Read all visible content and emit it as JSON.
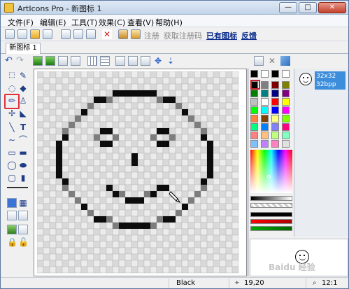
{
  "window": {
    "title": "ArtIcons Pro - 新图标 1",
    "btn_min": "—",
    "btn_max": "□",
    "btn_close": "✕"
  },
  "menu": [
    "文件(F)",
    "编辑(E)",
    "工具(T)",
    "效果(C)",
    "查看(V)",
    "帮助(H)"
  ],
  "toolbar": {
    "register": "注册",
    "get_code": "获取注册码",
    "have_icon": "已有图标",
    "feedback": "反馈"
  },
  "tab": {
    "label": "新图标 1"
  },
  "thumb": {
    "size": "32x32",
    "depth": "32bpp"
  },
  "status": {
    "color_name": "Black",
    "coords": "19,20",
    "zoom": "12:1"
  },
  "watermark": "Baidu 经验",
  "canvas_pixels": {
    "black": [
      [
        12,
        3
      ],
      [
        13,
        3
      ],
      [
        14,
        3
      ],
      [
        15,
        3
      ],
      [
        16,
        3
      ],
      [
        17,
        3
      ],
      [
        18,
        3
      ],
      [
        9,
        4
      ],
      [
        10,
        4
      ],
      [
        11,
        4
      ],
      [
        19,
        4
      ],
      [
        20,
        4
      ],
      [
        21,
        4
      ],
      [
        8,
        5
      ],
      [
        22,
        5
      ],
      [
        7,
        6
      ],
      [
        23,
        6
      ],
      [
        6,
        7
      ],
      [
        24,
        7
      ],
      [
        5,
        8
      ],
      [
        25,
        8
      ],
      [
        4,
        9
      ],
      [
        26,
        9
      ],
      [
        4,
        10
      ],
      [
        26,
        10
      ],
      [
        3,
        11
      ],
      [
        27,
        11
      ],
      [
        3,
        12
      ],
      [
        27,
        12
      ],
      [
        3,
        13
      ],
      [
        27,
        13
      ],
      [
        3,
        14
      ],
      [
        27,
        14
      ],
      [
        3,
        15
      ],
      [
        27,
        15
      ],
      [
        3,
        16
      ],
      [
        27,
        16
      ],
      [
        4,
        17
      ],
      [
        26,
        17
      ],
      [
        4,
        18
      ],
      [
        26,
        18
      ],
      [
        5,
        19
      ],
      [
        25,
        19
      ],
      [
        6,
        20
      ],
      [
        24,
        20
      ],
      [
        7,
        21
      ],
      [
        23,
        21
      ],
      [
        8,
        22
      ],
      [
        22,
        22
      ],
      [
        9,
        23
      ],
      [
        10,
        23
      ],
      [
        11,
        23
      ],
      [
        19,
        23
      ],
      [
        20,
        23
      ],
      [
        21,
        23
      ],
      [
        12,
        24
      ],
      [
        13,
        24
      ],
      [
        14,
        24
      ],
      [
        15,
        24
      ],
      [
        16,
        24
      ],
      [
        17,
        24
      ],
      [
        18,
        24
      ],
      [
        10,
        9
      ],
      [
        11,
        9
      ],
      [
        9,
        10
      ],
      [
        12,
        10
      ],
      [
        10,
        11
      ],
      [
        11,
        11
      ],
      [
        19,
        9
      ],
      [
        20,
        9
      ],
      [
        18,
        10
      ],
      [
        21,
        10
      ],
      [
        19,
        11
      ],
      [
        20,
        11
      ],
      [
        15,
        13
      ],
      [
        15,
        14
      ],
      [
        11,
        18
      ],
      [
        12,
        19
      ],
      [
        13,
        19
      ],
      [
        14,
        20
      ],
      [
        15,
        20
      ],
      [
        16,
        20
      ],
      [
        17,
        19
      ],
      [
        18,
        19
      ],
      [
        19,
        18
      ],
      [
        20,
        18
      ]
    ],
    "gray": [
      [
        11,
        4
      ],
      [
        19,
        4
      ],
      [
        8,
        5
      ],
      [
        22,
        5
      ],
      [
        6,
        7
      ],
      [
        24,
        7
      ],
      [
        4,
        9
      ],
      [
        26,
        9
      ],
      [
        4,
        18
      ],
      [
        26,
        18
      ],
      [
        6,
        20
      ],
      [
        24,
        20
      ],
      [
        8,
        22
      ],
      [
        22,
        22
      ],
      [
        11,
        23
      ],
      [
        19,
        23
      ],
      [
        12,
        24
      ],
      [
        18,
        24
      ],
      [
        5,
        8
      ],
      [
        25,
        8
      ],
      [
        5,
        19
      ],
      [
        25,
        19
      ],
      [
        9,
        10
      ],
      [
        12,
        10
      ],
      [
        18,
        10
      ],
      [
        21,
        10
      ],
      [
        13,
        19
      ],
      [
        17,
        19
      ]
    ]
  },
  "palette": [
    "#000000",
    "#808080",
    "#800000",
    "#808000",
    "#008000",
    "#008080",
    "#000080",
    "#800080",
    "#c0c0c0",
    "#ffffff",
    "#ff0000",
    "#ffff00",
    "#00ff00",
    "#00ffff",
    "#0000ff",
    "#ff00ff",
    "#ff8040",
    "#804000",
    "#ffff80",
    "#80ff00",
    "#00ff80",
    "#0080ff",
    "#8080ff",
    "#ff0080",
    "#ff8080",
    "#ffc080",
    "#c0ff80",
    "#80ffc0",
    "#80c0ff",
    "#c080ff",
    "#ff80c0",
    "#e0e0e0"
  ]
}
